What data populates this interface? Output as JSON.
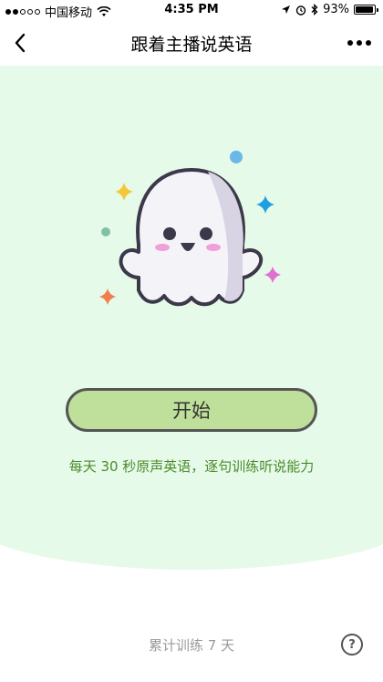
{
  "status_bar": {
    "carrier": "中国移动",
    "time": "4:35 PM",
    "battery": "93%",
    "battery_level": 0.93,
    "signal_bars": 2,
    "icons": [
      "wifi-icon",
      "location-icon",
      "alarm-icon",
      "bluetooth-icon",
      "battery-icon"
    ]
  },
  "nav": {
    "title": "跟着主播说英语"
  },
  "hero": {
    "start_label": "开始",
    "tagline": "每天 30 秒原声英语，逐句训练听说能力"
  },
  "footer": {
    "days_label": "累计训练 7 天",
    "help_label": "?"
  },
  "colors": {
    "hero_bg": "#e6fae9",
    "button_bg": "#bfe09a",
    "tagline": "#4c8a2a",
    "footer_text": "#9a9a9a"
  }
}
